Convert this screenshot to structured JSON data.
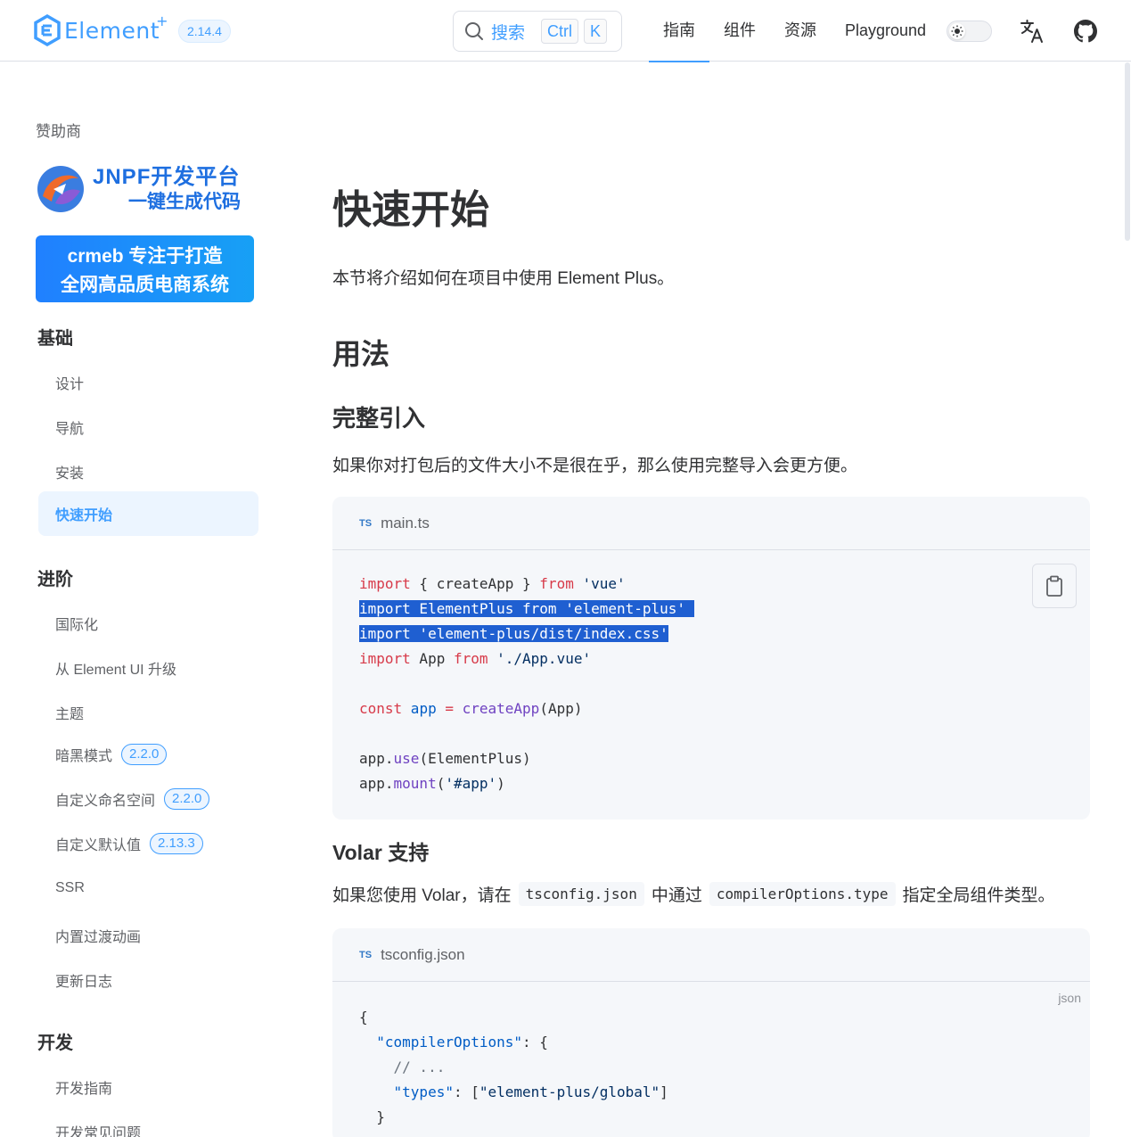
{
  "header": {
    "logo_text": "Element",
    "logo_plus": "+",
    "version": "2.14.4",
    "search": {
      "label": "搜索",
      "key1": "Ctrl",
      "key2": "K"
    },
    "nav": [
      "指南",
      "组件",
      "资源",
      "Playground"
    ],
    "active_nav": "指南",
    "theme_toggle_icon": "sun-icon",
    "translate_icon": "translate-icon",
    "github_icon": "github-icon"
  },
  "sidebar": {
    "sponsor_title": "赞助商",
    "ad1": {
      "line1": "JNPF开发平台",
      "line2": "一键生成代码"
    },
    "ad2": {
      "line1": "crmeb 专注于打造",
      "line2": "全网高品质电商系统"
    },
    "sections": [
      {
        "title": "基础",
        "items": [
          {
            "label": "设计"
          },
          {
            "label": "导航"
          },
          {
            "label": "安装"
          },
          {
            "label": "快速开始",
            "active": true
          }
        ]
      },
      {
        "title": "进阶",
        "items": [
          {
            "label": "国际化"
          },
          {
            "label": "从 Element UI 升级"
          },
          {
            "label": "主题"
          },
          {
            "label": "暗黑模式",
            "badge": "2.2.0"
          },
          {
            "label": "自定义命名空间",
            "badge": "2.2.0"
          },
          {
            "label": "自定义默认值",
            "badge": "2.13.3"
          },
          {
            "label": "SSR"
          },
          {
            "label": "内置过渡动画"
          },
          {
            "label": "更新日志"
          }
        ]
      },
      {
        "title": "开发",
        "items": [
          {
            "label": "开发指南"
          },
          {
            "label": "开发常见问题"
          }
        ]
      }
    ]
  },
  "main": {
    "title": "快速开始",
    "intro": "本节将介绍如何在项目中使用 Element Plus。",
    "h2_usage": "用法",
    "h3_full": "完整引入",
    "p_full": "如果你对打包后的文件大小不是很在乎，那么使用完整导入会更方便。",
    "code1": {
      "icon": "TS",
      "filename": "main.ts",
      "copy_icon": "clipboard-icon",
      "lines": {
        "l1_kw": "import",
        "l1_mid": " { createApp } ",
        "l1_kw2": "from",
        "l1_str": " 'vue'",
        "l2": "import ElementPlus from 'element-plus'",
        "l3": "import 'element-plus/dist/index.css'",
        "l4_kw": "import",
        "l4_mid": " App ",
        "l4_kw2": "from",
        "l4_str": " './App.vue'",
        "l6_kw": "const",
        "l6_var": " app",
        "l6_eq": " = ",
        "l6_fn": "createApp",
        "l6_rest": "(App)",
        "l8_a": "app.",
        "l8_fn": "use",
        "l8_rest": "(ElementPlus)",
        "l9_a": "app.",
        "l9_fn": "mount",
        "l9_p1": "(",
        "l9_str": "'#app'",
        "l9_p2": ")"
      }
    },
    "h3_volar": "Volar 支持",
    "p_volar": {
      "part1": "如果您使用 Volar，请在",
      "code1": "tsconfig.json",
      "part2": "中通过",
      "code2": "compilerOptions.type",
      "part3": "指定全局组件类型。"
    },
    "code2": {
      "icon": "TS",
      "filename": "tsconfig.json",
      "lang": "json",
      "lines": {
        "l1": "{",
        "l2_key": "\"compilerOptions\"",
        "l2_rest": ": {",
        "l3": "// ...",
        "l4_key": "\"types\"",
        "l4_mid": ": [",
        "l4_str": "\"element-plus/global\"",
        "l4_end": "]",
        "l5": "}",
        "l6": "}"
      }
    }
  }
}
